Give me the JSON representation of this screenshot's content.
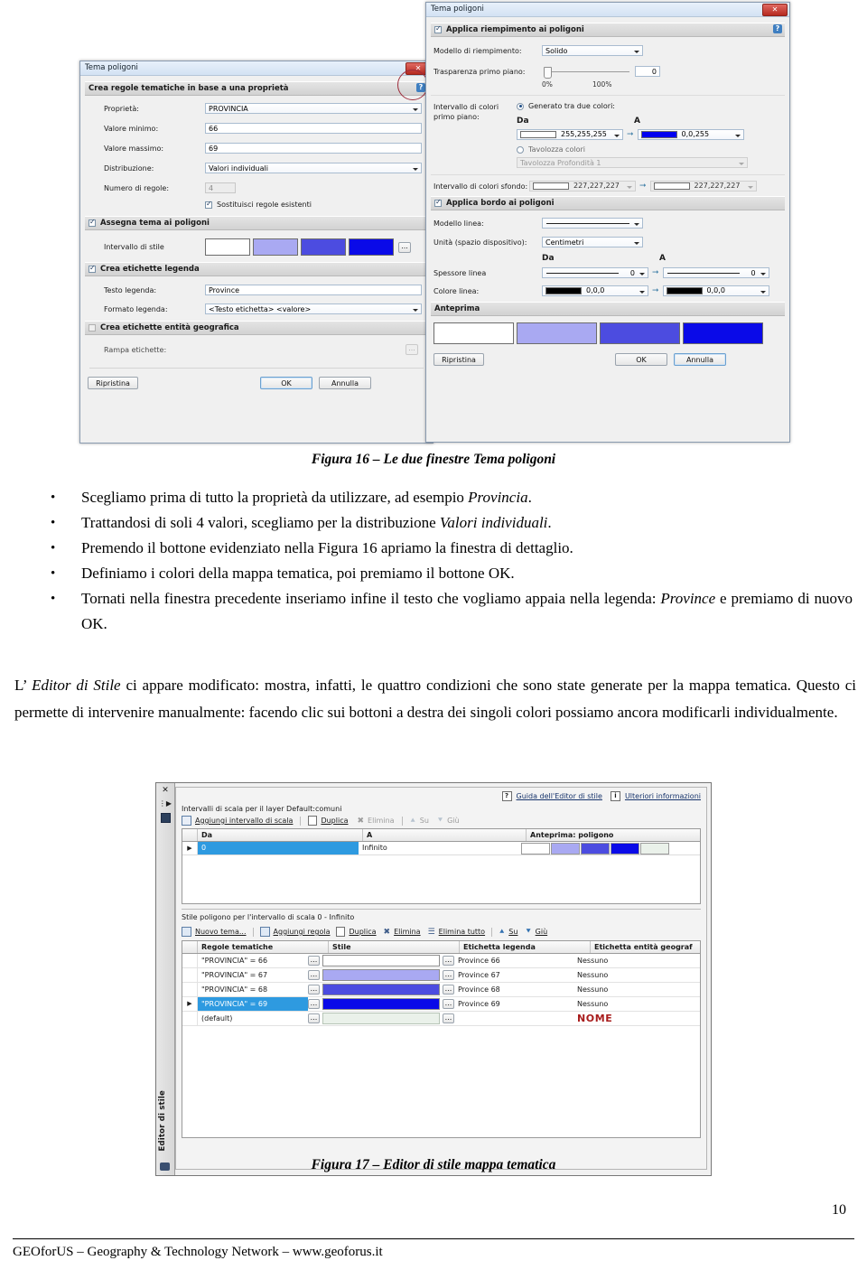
{
  "figure16": {
    "caption": "Figura 16 – Le due finestre Tema poligoni",
    "left_dialog": {
      "title": "Tema poligoni",
      "close_glyph": "✕",
      "group1_title": "Crea regole tematiche in base a una proprietà",
      "help_glyph": "?",
      "fields": [
        {
          "label": "Proprietà:",
          "value": "PROVINCIA",
          "kind": "combo"
        },
        {
          "label": "Valore minimo:",
          "value": "66",
          "kind": "input"
        },
        {
          "label": "Valore massimo:",
          "value": "69",
          "kind": "input"
        },
        {
          "label": "Distribuzione:",
          "value": "Valori individuali",
          "kind": "combo"
        },
        {
          "label": "Numero di regole:",
          "value": "4",
          "kind": "input-disabled"
        }
      ],
      "replace_rules_checkbox": {
        "label": "Sostituisci regole esistenti",
        "checked": true
      },
      "group2_title": "Assegna tema ai poligoni",
      "group2_checked": true,
      "style_range_label": "Intervallo di stile",
      "style_swatches": [
        "#ffffff",
        "#a9a9f2",
        "#4c4ce0",
        "#0a0ae8"
      ],
      "style_ellipsis_button": "...",
      "group3_title": "Crea etichette legenda",
      "group3_checked": true,
      "legend_text_label": "Testo legenda:",
      "legend_text_value": "Province",
      "legend_format_label": "Formato legenda:",
      "legend_format_value": "<Testo etichetta> <valore>",
      "group4_title": "Crea etichette entità geografica",
      "group4_checked": false,
      "label_ramp_label": "Rampa etichette:",
      "label_ramp_button": "...",
      "buttons": {
        "restore": "Ripristina",
        "ok": "OK",
        "cancel": "Annulla"
      }
    },
    "right_dialog": {
      "title": "Tema poligoni",
      "close_glyph": "✕",
      "help_glyph": "?",
      "group1_title": "Applica riempimento ai poligoni",
      "group1_checked": true,
      "fill_pattern_label": "Modello di riempimento:",
      "fill_pattern_value": "Solido",
      "transparency_label": "Trasparenza primo piano:",
      "transparency_value": "0",
      "transparency_min": "0%",
      "transparency_max": "100%",
      "fg_color_range_label": "Intervallo di colori primo piano:",
      "generated_radio_label": "Generato tra due colori:",
      "generated_radio_checked": true,
      "col_da": "Da",
      "col_a": "A",
      "fg_from_color": "#ffffff",
      "fg_from_value": "255,255,255",
      "fg_to_color": "#0000f0",
      "fg_to_value": "0,0,255",
      "palette_radio_label": "Tavolozza colori",
      "palette_radio_checked": false,
      "palette_value": "Tavolozza Profondità 1",
      "bg_color_range_label": "Intervallo di colori sfondo:",
      "bg_from_color": "#ffffff",
      "bg_from_value": "227,227,227",
      "bg_to_color": "#ffffff",
      "bg_to_value": "227,227,227",
      "group2_title": "Applica bordo ai poligoni",
      "group2_checked": true,
      "line_pattern_label": "Modello linea:",
      "unit_label": "Unità (spazio dispositivo):",
      "unit_value": "Centimetri",
      "line_width_label": "Spessore linea",
      "line_width_from": "0",
      "line_width_to": "0",
      "line_color_label": "Colore linea:",
      "line_color_from_color": "#000000",
      "line_color_from_value": "0,0,0",
      "line_color_to_color": "#000000",
      "line_color_to_value": "0,0,0",
      "preview_title": "Anteprima",
      "preview_swatches": [
        "#ffffff",
        "#a9a9f2",
        "#4c4ce0",
        "#0a0ae8"
      ],
      "buttons": {
        "restore": "Ripristina",
        "ok": "OK",
        "cancel": "Annulla"
      }
    }
  },
  "bullets": [
    {
      "html": "Scegliamo prima di tutto la proprietà da utilizzare, ad esempio <i>Provincia</i>."
    },
    {
      "html": "Trattandosi di soli 4 valori, scegliamo per la distribuzione <i>Valori individuali</i>."
    },
    {
      "html": "Premendo il bottone evidenziato nella Figura 16 apriamo la finestra di dettaglio."
    },
    {
      "html": "Definiamo i colori della mappa tematica, poi premiamo il bottone OK."
    },
    {
      "html": "Tornati nella finestra precedente inseriamo infine il testo che vogliamo appaia nella legenda: <i>Province</i> e premiamo di nuovo OK."
    }
  ],
  "paragraph": {
    "html": "L’ <i>Editor di Stile</i> ci appare modificato: mostra, infatti, le quattro condizioni che sono state generate per la mappa tematica. Questo ci permette di intervenire manualmente: facendo clic sui bottoni a destra dei singoli colori possiamo ancora modificarli individualmente."
  },
  "figure17": {
    "caption": "Figura 17 – Editor di stile mappa tematica",
    "sidebar_label": "Editor di stile",
    "sidebar_icons": [
      "close-icon",
      "expand-icon",
      "panel-icon",
      "binoculars-icon"
    ],
    "help_link_1": "Guida dell'Editor di stile",
    "help_link_1_badge": "?",
    "help_link_2": "Ulteriori informazioni",
    "help_link_2_badge": "i",
    "scale_section_label": "Intervalli di scala per il layer Default:comuni",
    "scale_toolbar": [
      {
        "label": "Aggiungi intervallo di scala",
        "enabled": true
      },
      {
        "label": "Duplica",
        "enabled": true
      },
      {
        "label": "Elimina",
        "enabled": false
      },
      {
        "label": "Su",
        "enabled": false
      },
      {
        "label": "Giù",
        "enabled": false
      }
    ],
    "scale_headers": [
      "",
      "Da",
      "A",
      "Anteprima: poligono"
    ],
    "scale_row": {
      "da": "0",
      "a": "Infinito",
      "swatches": [
        "#ffffff",
        "#a9a9f2",
        "#4c4ce0",
        "#0a0ae8",
        "#eaf1ea"
      ]
    },
    "style_section_label": "Stile poligono per l'intervallo di scala 0 - Infinito",
    "style_toolbar": [
      {
        "label": "Nuovo tema...",
        "enabled": true
      },
      {
        "label": "Aggiungi regola",
        "enabled": true
      },
      {
        "label": "Duplica",
        "enabled": true
      },
      {
        "label": "Elimina",
        "enabled": true
      },
      {
        "label": "Elimina tutto",
        "enabled": true
      },
      {
        "label": "Su",
        "enabled": true
      },
      {
        "label": "Giù",
        "enabled": true
      }
    ],
    "style_headers": [
      "",
      "Regole tematiche",
      "Stile",
      "Etichetta legenda",
      "Etichetta entità geograf"
    ],
    "style_rows": [
      {
        "rule": "\"PROVINCIA\" = 66",
        "swatch": "#ffffff",
        "legend": "Province 66",
        "geo": "Nessuno",
        "selected": false
      },
      {
        "rule": "\"PROVINCIA\" = 67",
        "swatch": "#a9a9f2",
        "legend": "Province 67",
        "geo": "Nessuno",
        "selected": false
      },
      {
        "rule": "\"PROVINCIA\" = 68",
        "swatch": "#4c4ce0",
        "legend": "Province 68",
        "geo": "Nessuno",
        "selected": false
      },
      {
        "rule": "\"PROVINCIA\" = 69",
        "swatch": "#0a0ae8",
        "legend": "Province 69",
        "geo": "Nessuno",
        "selected": true
      },
      {
        "rule": "(default)",
        "swatch": "#eaf1ea",
        "legend": "",
        "geo": "NOME",
        "selected": false
      }
    ],
    "ellipsis_button": "...",
    "geo_highlight_color": "#a81c1c"
  },
  "footer": {
    "text": "GEOforUS – Geography & Technology Network – www.geoforus.it",
    "page_number": "10"
  }
}
